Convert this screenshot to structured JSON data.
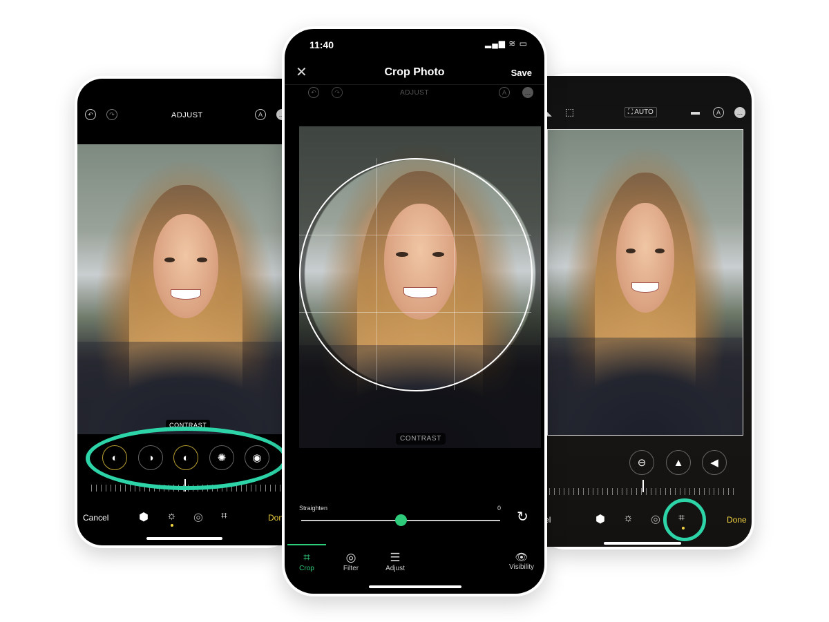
{
  "left_phone": {
    "toolbar_title": "ADJUST",
    "icons": [
      "undo-icon",
      "redo-icon",
      "markup-icon",
      "more-icon"
    ],
    "active_label": "CONTRAST",
    "adjust_dials": [
      {
        "name": "exposure-dial",
        "glyph": "◐"
      },
      {
        "name": "brilliance-dial",
        "glyph": "◑"
      },
      {
        "name": "contrast-dial",
        "glyph": "◐"
      },
      {
        "name": "brightness-dial",
        "glyph": "✺"
      },
      {
        "name": "black-point-dial",
        "glyph": "◉"
      }
    ],
    "cancel_label": "Cancel",
    "done_label": "Done",
    "bottom_tabs": [
      {
        "name": "live-icon",
        "glyph": "⬢"
      },
      {
        "name": "adjust-icon",
        "glyph": "☼"
      },
      {
        "name": "filters-icon",
        "glyph": "◎"
      },
      {
        "name": "crop-rotate-icon",
        "glyph": "⌗"
      }
    ]
  },
  "center_phone": {
    "status_time": "11:40",
    "header": {
      "close_glyph": "✕",
      "title": "Crop Photo",
      "save_label": "Save"
    },
    "sub_toolbar_title": "ADJUST",
    "overlay_label": "CONTRAST",
    "straighten": {
      "label": "Straighten",
      "value": "0",
      "position": 0.5
    },
    "tabs": [
      {
        "label": "Crop",
        "glyph": "⌗",
        "active": true
      },
      {
        "label": "Filter",
        "glyph": "◎",
        "active": false
      },
      {
        "label": "Adjust",
        "glyph": "☰",
        "active": false
      },
      {
        "label": "Visibility",
        "glyph": "👁",
        "active": false
      }
    ],
    "accent_color": "#2ecc7a"
  },
  "right_phone": {
    "auto_label": "AUTO",
    "cancel_label": "Cancel",
    "done_label": "Done",
    "perspective_dials": [
      {
        "name": "straighten-dial",
        "glyph": "⊖"
      },
      {
        "name": "vertical-perspective-dial",
        "glyph": "▲"
      },
      {
        "name": "horizontal-perspective-dial",
        "glyph": "◀"
      }
    ],
    "bottom_tabs": [
      {
        "name": "live-icon",
        "glyph": "⬢"
      },
      {
        "name": "adjust-icon",
        "glyph": "☼"
      },
      {
        "name": "filters-icon",
        "glyph": "◎"
      },
      {
        "name": "crop-rotate-icon",
        "glyph": "⌗"
      }
    ]
  },
  "highlight_color": "#2dd4a8",
  "ios_accent": "#f5d742"
}
